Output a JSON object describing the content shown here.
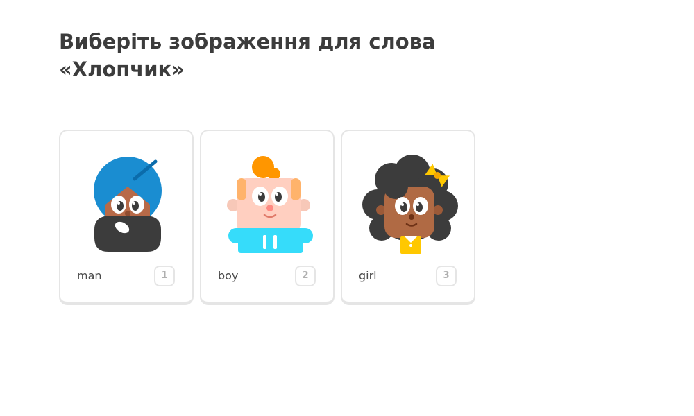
{
  "prompt": {
    "title": "Виберіть зображення для слова «Хлопчик»"
  },
  "choices": [
    {
      "label": "man",
      "key": "1",
      "illustration": "man-with-turban-illustration"
    },
    {
      "label": "boy",
      "key": "2",
      "illustration": "boy-illustration"
    },
    {
      "label": "girl",
      "key": "3",
      "illustration": "girl-with-bow-illustration"
    }
  ],
  "colors": {
    "title": "#3c3c3c",
    "card_border": "#e5e5e5",
    "key_text": "#afafaf",
    "turban_blue": "#1a8dd1",
    "hair_orange": "#ff9600",
    "shirt_cyan": "#36dcfa",
    "bow_yellow": "#ffc800"
  }
}
